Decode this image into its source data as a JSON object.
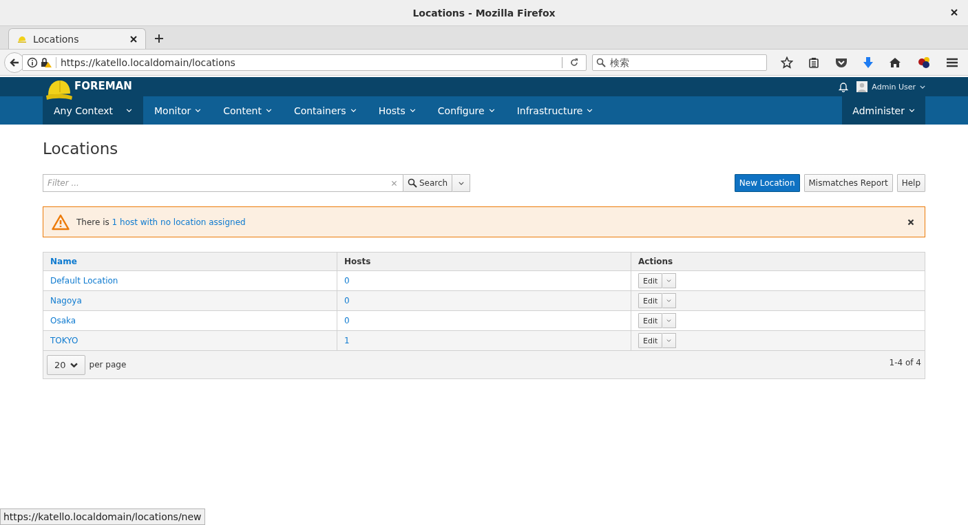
{
  "window": {
    "title": "Locations - Mozilla Firefox"
  },
  "browser": {
    "tabs": [
      {
        "label": "Locations",
        "selected": true
      }
    ],
    "url": "https://katello.localdomain/locations",
    "search": {
      "placeholder": "検索"
    }
  },
  "header": {
    "brand": "FOREMAN",
    "user": "Admin User"
  },
  "nav": {
    "context": "Any Context",
    "menus": [
      "Monitor",
      "Content",
      "Containers",
      "Hosts",
      "Configure",
      "Infrastructure"
    ],
    "admin": "Administer"
  },
  "page": {
    "title": "Locations",
    "filter": {
      "placeholder": "Filter ..."
    },
    "search_button": "Search",
    "actions": [
      {
        "label": "New Location",
        "kind": "primary"
      },
      {
        "label": "Mismatches Report",
        "kind": "default"
      },
      {
        "label": "Help",
        "kind": "default"
      }
    ],
    "alert": {
      "text": "There is",
      "link": "1 host with no location assigned"
    },
    "table": {
      "columns": [
        {
          "label": "Name",
          "sortable": true
        },
        {
          "label": "Hosts",
          "sortable": false
        },
        {
          "label": "Actions",
          "sortable": false
        }
      ],
      "rows": [
        {
          "name": "Default Location",
          "hosts": "0",
          "action": "Edit"
        },
        {
          "name": "Nagoya",
          "hosts": "0",
          "action": "Edit"
        },
        {
          "name": "Osaka",
          "hosts": "0",
          "action": "Edit"
        },
        {
          "name": "TOKYO",
          "hosts": "1",
          "action": "Edit"
        }
      ]
    },
    "pagination": {
      "per_page": "20",
      "per_page_label": "per page",
      "range": "1-4 of 4"
    }
  },
  "status_bar": {
    "url": "https://katello.localdomain/locations/new"
  }
}
